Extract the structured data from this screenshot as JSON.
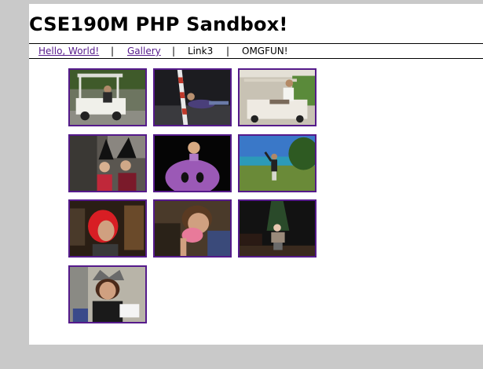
{
  "header": {
    "title": "CSE190M PHP Sandbox!"
  },
  "nav": {
    "items": [
      {
        "label": "Hello, World!",
        "link": true
      },
      {
        "label": "Gallery",
        "link": true
      },
      {
        "label": "Link3",
        "link": false
      },
      {
        "label": "OMGFUN!",
        "link": false
      }
    ],
    "separator": "|"
  },
  "gallery": {
    "thumbnails": [
      {
        "subject": "golf-cart-photo"
      },
      {
        "subject": "person-lying-by-pole-photo"
      },
      {
        "subject": "person-in-cart-photo"
      },
      {
        "subject": "witch-hats-photo"
      },
      {
        "subject": "purple-costume-photo"
      },
      {
        "subject": "beach-cliff-photo"
      },
      {
        "subject": "red-hair-photo"
      },
      {
        "subject": "pink-mask-photo"
      },
      {
        "subject": "night-yard-photo"
      },
      {
        "subject": "hat-portrait-photo"
      }
    ]
  }
}
